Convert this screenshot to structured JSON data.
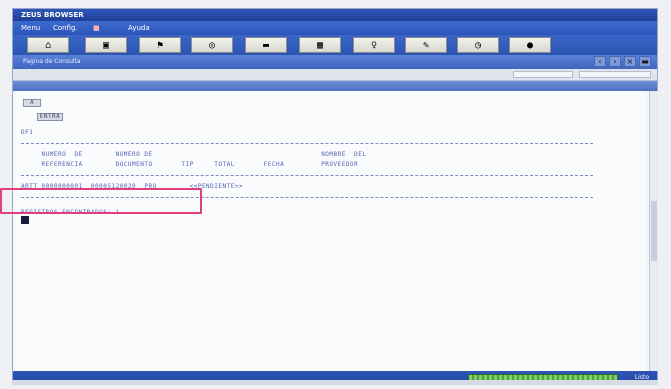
{
  "window": {
    "title": "ZEUS BROWSER"
  },
  "menu": [
    "Menu",
    "Config.",
    "Ayuda"
  ],
  "toolbar_icons": [
    "home-icon",
    "folder-icon",
    "flag-icon",
    "globe-icon",
    "car-icon",
    "calendar-icon",
    "lamp-icon",
    "edit-icon",
    "clock-icon",
    "info-icon"
  ],
  "address": {
    "label": "Pagina de Consulta"
  },
  "sub_button": "A",
  "sub_button2": "ENTRA",
  "program_line": "DF1",
  "headers": {
    "row1": "     NUMERO  DE        NUMERO DE                                         NOMBRE  DEL",
    "row2": "     REFERENCIA        DOCUMENTO       TIP     TOTAL       FECHA         PROVEEDOR"
  },
  "data_row": "ARTT 0000000001  00005120020  PRO        <<PENDIENTE>>",
  "result_line": "REGISTROS ENCONTRADOS: 1",
  "status": {
    "right_text": "Listo"
  },
  "colors": {
    "accent": "#2b55b8",
    "text": "#5562b8",
    "highlight": "#e0407a"
  }
}
